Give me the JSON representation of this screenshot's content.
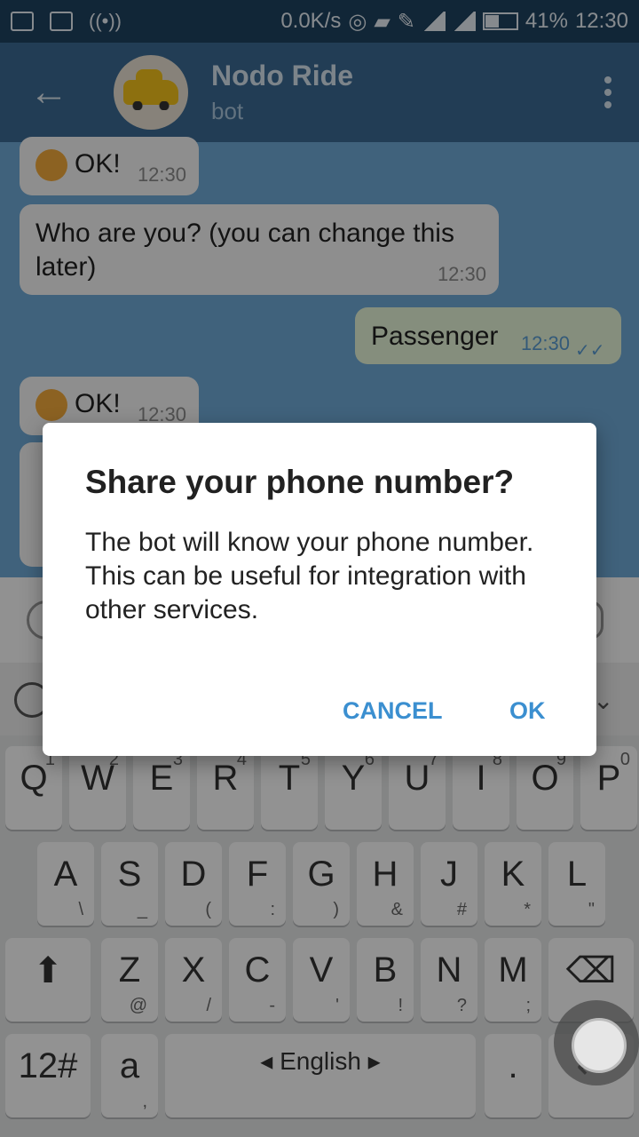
{
  "status": {
    "speed": "0.0K/s",
    "battery": "41%",
    "time": "12:30",
    "battery_level": 0.41
  },
  "header": {
    "title": "Nodo Ride",
    "subtitle": "bot"
  },
  "messages": [
    {
      "text": "OK!",
      "time": "12:30",
      "direction": "in"
    },
    {
      "text": "Who are you? (you can change this later)",
      "time": "12:30",
      "direction": "in"
    },
    {
      "text": "Passenger",
      "time": "12:30",
      "direction": "out"
    },
    {
      "text": "OK!",
      "time": "12:30",
      "direction": "in"
    }
  ],
  "dialog": {
    "title": "Share your phone number?",
    "body": "The bot will know your phone number. This can be useful for integration with other services.",
    "cancel_label": "CANCEL",
    "ok_label": "OK"
  },
  "keyboard": {
    "rows": [
      [
        {
          "k": "Q",
          "s": "1"
        },
        {
          "k": "W",
          "s": "2"
        },
        {
          "k": "E",
          "s": "3"
        },
        {
          "k": "R",
          "s": "4"
        },
        {
          "k": "T",
          "s": "5"
        },
        {
          "k": "Y",
          "s": "6"
        },
        {
          "k": "U",
          "s": "7"
        },
        {
          "k": "I",
          "s": "8"
        },
        {
          "k": "O",
          "s": "9"
        },
        {
          "k": "P",
          "s": "0"
        }
      ],
      [
        {
          "k": "A",
          "s": "\\"
        },
        {
          "k": "S",
          "s": "_"
        },
        {
          "k": "D",
          "s": "("
        },
        {
          "k": "F",
          "s": ":"
        },
        {
          "k": "G",
          "s": ")"
        },
        {
          "k": "H",
          "s": "&"
        },
        {
          "k": "J",
          "s": "#"
        },
        {
          "k": "K",
          "s": "*"
        },
        {
          "k": "L",
          "s": "\""
        }
      ],
      [
        {
          "k": "⬆",
          "s": ""
        },
        {
          "k": "Z",
          "s": "@"
        },
        {
          "k": "X",
          "s": "/"
        },
        {
          "k": "C",
          "s": "-"
        },
        {
          "k": "V",
          "s": "'"
        },
        {
          "k": "B",
          "s": "!"
        },
        {
          "k": "N",
          "s": "?"
        },
        {
          "k": "M",
          "s": ";"
        },
        {
          "k": "⌫",
          "s": ""
        }
      ],
      [
        {
          "k": "12#",
          "s": ""
        },
        {
          "k": "a",
          "s": ","
        },
        {
          "k": "◂ English ▸",
          "s": ""
        },
        {
          "k": ".",
          "s": ""
        },
        {
          "k": "↵",
          "s": ""
        }
      ]
    ]
  },
  "colors": {
    "header": "#3b6a93",
    "accent": "#3b8fd0",
    "chat_bg": "#6fa9d6"
  }
}
